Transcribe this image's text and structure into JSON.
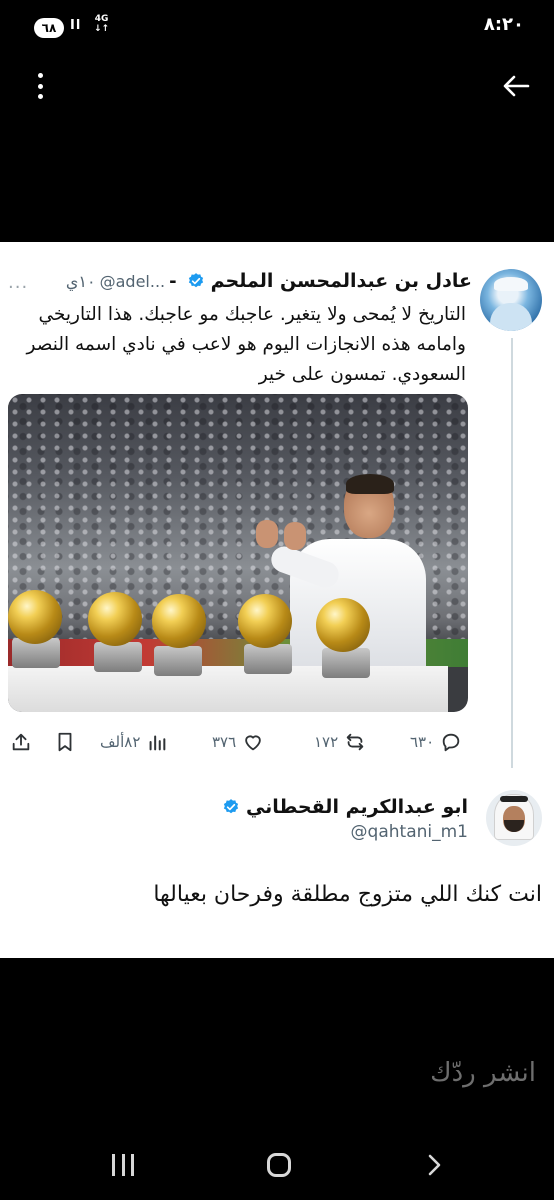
{
  "status_bar": {
    "time": "٨:٢٠",
    "battery": "٦٨",
    "signal": "Il",
    "network_top": "4G",
    "network_bottom": "↓↑"
  },
  "quoted_tweet": {
    "author_name": "عادل بن عبدالمحسن الملحم",
    "separator": "-",
    "handle": "@adel...",
    "time": "١٠ي",
    "more": "...",
    "text": "التاريخ لا يُمحى ولا يتغير. عاجبك مو عاجبك. هذا التاريخي وامامه هذه الانجازات اليوم هو لاعب في نادي اسمه النصر السعودي. تمسون على خير",
    "stats": {
      "replies": "٦٣٠",
      "retweets": "١٧٢",
      "likes": "٣٧٦",
      "views": "٨٢ألف"
    }
  },
  "reply": {
    "author_name": "ابو عبدالكريم القحطاني",
    "handle": "@qahtani_m1",
    "text": "انت كنك اللي متزوج مطلقة وفرحان بعيالها"
  },
  "publish_reply_label": "انشر ردّك",
  "colors": {
    "verified": "#1d9bf0",
    "muted": "#536471",
    "background": "#000000",
    "card": "#ffffff"
  },
  "icons": [
    "back-arrow-icon",
    "more-vertical-icon",
    "verified-badge-icon",
    "reply-icon",
    "retweet-icon",
    "like-icon",
    "views-icon",
    "bookmark-icon",
    "share-icon",
    "nav-recent-icon",
    "nav-home-icon",
    "nav-back-icon"
  ]
}
